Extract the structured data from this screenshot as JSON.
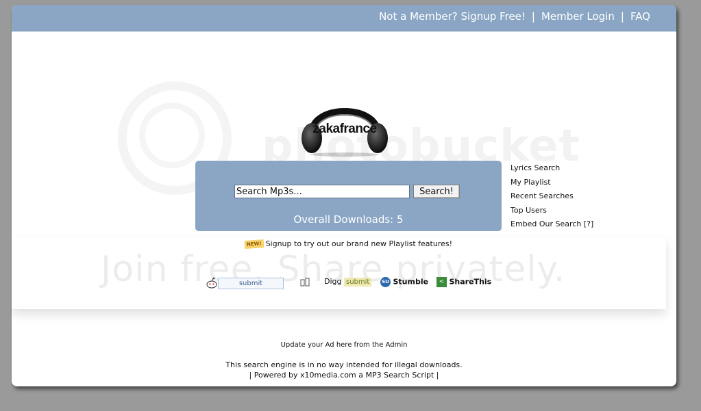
{
  "header": {
    "not_member": "Not a Member?",
    "signup": "Signup Free!",
    "separator": "|",
    "member_login": "Member Login",
    "faq": "FAQ"
  },
  "watermark": {
    "brand": "photobucket",
    "tagline": "Join free. Share privately."
  },
  "logo": {
    "text": "zakafrance"
  },
  "search": {
    "input_value": "Search Mp3s...",
    "button_label": "Search!",
    "downloads_text": "Overall Downloads: 5"
  },
  "sidelinks": [
    "Lyrics Search",
    "My Playlist",
    "Recent Searches",
    "Top Users",
    "Embed Our Search [?]"
  ],
  "notice": {
    "badge": "NEW!",
    "text": "Signup to try out our brand new Playlist features!"
  },
  "social": {
    "reddit_submit": "submit",
    "digg_label": "Digg",
    "digg_submit": "submit",
    "stumble_badge": "SU",
    "stumble_label": "Stumble",
    "share_label": "ShareThis"
  },
  "footer": {
    "ad": "Update your Ad here from the Admin",
    "disclaimer": "This search engine is in no way intended for illegal downloads.",
    "powered": "| Powered by x10media.com a MP3 Search Script |"
  },
  "colors": {
    "page_background": "#9a9a9a",
    "accent_blue": "#8aa6c4",
    "card_background": "#ffffff"
  }
}
